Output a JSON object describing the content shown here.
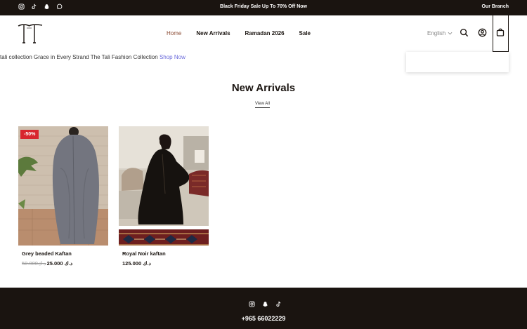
{
  "topbar": {
    "promo": "Black Friday Sale Up To 70% Off Now",
    "branch": "Our Branch",
    "social_icons": [
      "instagram-icon",
      "tiktok-icon",
      "snapchat-icon",
      "whatsapp-icon"
    ]
  },
  "header": {
    "logo_text": "TT",
    "nav": [
      "Home",
      "New Arrivals",
      "Ramadan 2026",
      "Sale"
    ],
    "active_nav": "Home",
    "language": "English",
    "icons": [
      "search-icon",
      "account-icon",
      "cart-icon"
    ]
  },
  "marquee": {
    "text": "tali collection Grace in Every Strand The Tali Fashion Collection ",
    "link": "Shop Now"
  },
  "section": {
    "title": "New Arrivals",
    "view_all": "View All"
  },
  "products": [
    {
      "name": "Grey beaded Kaftan",
      "badge": "-50%",
      "old_price": "50.000د.ك",
      "price": "25.000 د.ك"
    },
    {
      "name": "Royal Noir kaftan",
      "price": "125.000 د.ك"
    }
  ],
  "footer": {
    "phone": "+965 66022229",
    "social_icons": [
      "instagram-icon",
      "snapchat-icon",
      "tiktok-icon"
    ]
  },
  "colors": {
    "dark": "#1a1410",
    "sale_badge": "#d8262e",
    "active_nav": "#8a4a32",
    "link": "#6a6adb"
  }
}
